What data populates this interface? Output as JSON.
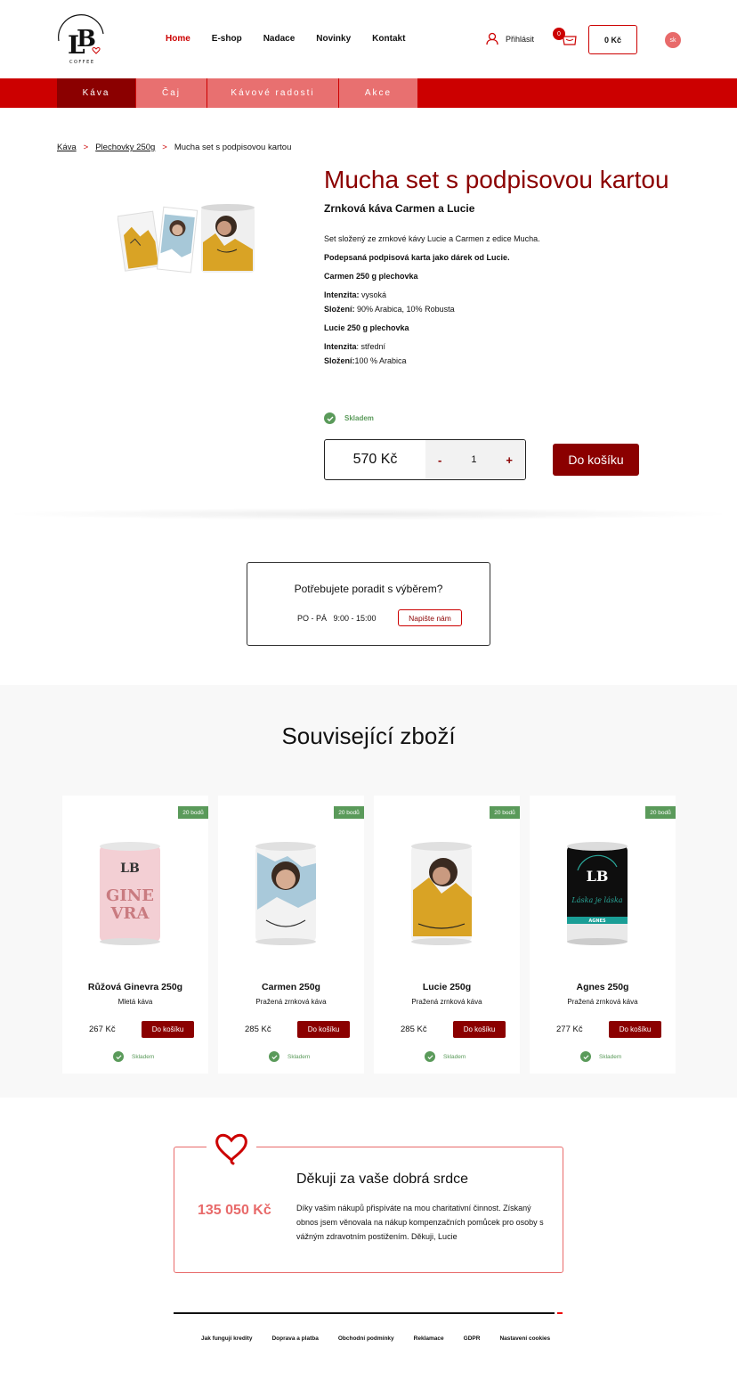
{
  "header": {
    "logo_text": "COFFEE",
    "nav": [
      "Home",
      "E-shop",
      "Nadace",
      "Novinky",
      "Kontakt"
    ],
    "login": "Přihlásit",
    "cart_count": "0",
    "cart_total": "0 Kč",
    "lang": "sk"
  },
  "categories": [
    "Káva",
    "Čaj",
    "Kávové radosti",
    "Akce"
  ],
  "breadcrumb": [
    "Káva",
    "Plechovky 250g",
    "Mucha set s podpisovou kartou"
  ],
  "breadcrumb_sep": ">",
  "product": {
    "title": "Mucha set s podpisovou kartou",
    "subtitle": "Zrnková káva Carmen a Lucie",
    "desc1": "Set složený ze zrnkové kávy Lucie a Carmen z edice Mucha.",
    "desc2": "Podepsaná podpisová karta jako dárek od Lucie.",
    "carmen_heading": "Carmen 250 g plechovka",
    "carmen_intensity_label": "Intenzita:",
    "carmen_intensity": " vysoká",
    "carmen_comp_label": "Složení:",
    "carmen_comp": " 90% Arabica, 10% Robusta",
    "lucie_heading": "Lucie 250 g plechovka",
    "lucie_intensity_label": "Intenzita",
    "lucie_intensity": ": střední",
    "lucie_comp_label": "Složení:",
    "lucie_comp": "100 % Arabica",
    "stock": "Skladem",
    "price": "570 Kč",
    "qty": "1",
    "minus": "-",
    "plus": "+",
    "add_to_cart": "Do košíku"
  },
  "help": {
    "title": "Potřebujete poradit s výběrem?",
    "hours": "PO - PÁ   9:00 - 15:00",
    "button": "Napište nám"
  },
  "related": {
    "title": "Související zboží",
    "items": [
      {
        "badge": "20 bodů",
        "name": "Růžová Ginevra 250g",
        "type": "Mletá káva",
        "price": "267 Kč",
        "button": "Do košíku",
        "stock": "Skladem",
        "can_text": "GINE VRA"
      },
      {
        "badge": "20 bodů",
        "name": "Carmen 250g",
        "type": "Pražená zrnková káva",
        "price": "285 Kč",
        "button": "Do košíku",
        "stock": "Skladem"
      },
      {
        "badge": "20 bodů",
        "name": "Lucie 250g",
        "type": "Pražená zrnková káva",
        "price": "285 Kč",
        "button": "Do košíku",
        "stock": "Skladem"
      },
      {
        "badge": "20 bodů",
        "name": "Agnes 250g",
        "type": "Pražená zrnková káva",
        "price": "277 Kč",
        "button": "Do košíku",
        "stock": "Skladem",
        "can_text": "Láska je láska",
        "can_label": "AGNES"
      }
    ]
  },
  "thanks": {
    "title": "Děkuji za vaše dobrá srdce",
    "amount": "135 050 Kč",
    "text": "Díky vašim nákupů přispíváte na mou charitativní činnost. Získaný obnos jsem věnovala na nákup kompenzačních pomůcek pro osoby s vážným zdravotním postižením. Děkuji, Lucie"
  },
  "footer": [
    "Jak fungují kredity",
    "Doprava a platba",
    "Obchodní podmínky",
    "Reklamace",
    "GDPR",
    "Nastavení cookies"
  ],
  "colors": {
    "brand_red": "#cc0000",
    "dark_red": "#8b0000",
    "light_red": "#e87070",
    "stock_green": "#5a9a5a"
  }
}
